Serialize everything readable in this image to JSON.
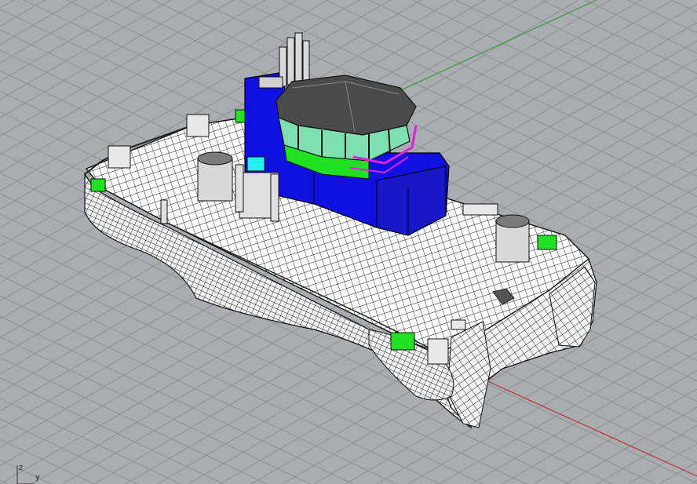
{
  "viewport": {
    "name": "perspective-viewport",
    "background": "#a9acb0",
    "grid_color": "#8e9194",
    "axis_x_color": "#c03030",
    "axis_y_color": "#3a9a3a"
  },
  "model": {
    "hull_color": "#ffffff",
    "mesh_color": "#1a1a1a",
    "superstructure_color": "#1010e0",
    "window_color": "#7ee0b0",
    "highlight_green": "#22e022",
    "highlight_magenta": "#e020e0",
    "highlight_cyan": "#22f0f0"
  },
  "axis_gizmo": {
    "z_label": "z",
    "y_label": "y"
  }
}
